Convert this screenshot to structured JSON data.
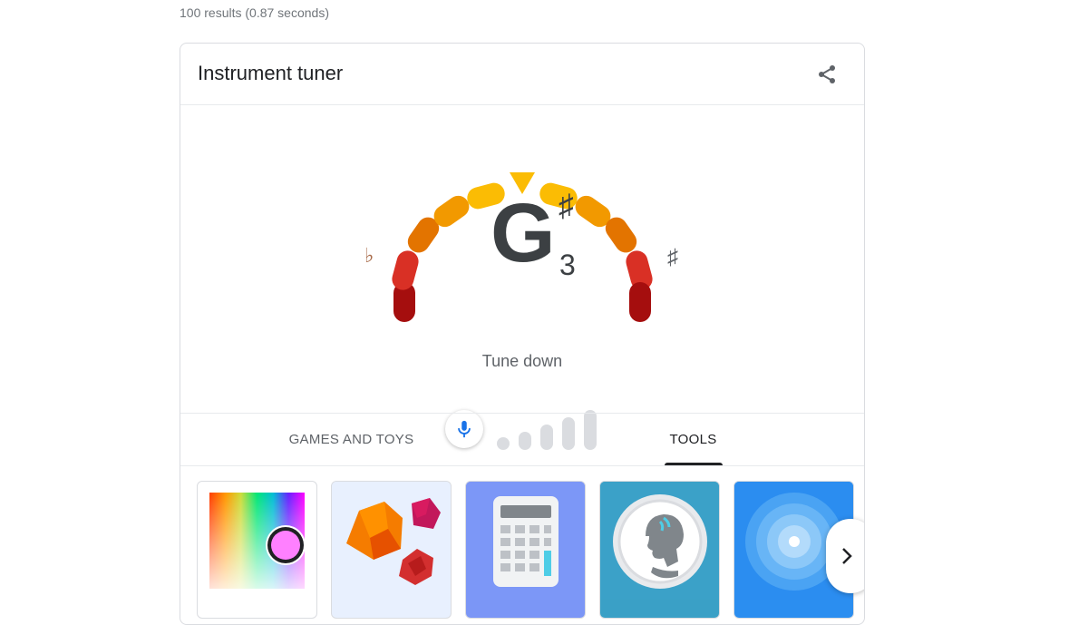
{
  "results_stats": "100 results (0.87 seconds)",
  "card": {
    "title": "Instrument tuner",
    "share_icon": "share-icon"
  },
  "tuner": {
    "note": "G",
    "accidental": "♯",
    "octave": "3",
    "flat_symbol": "♭",
    "sharp_symbol": "♯",
    "instruction": "Tune down",
    "mic_icon": "microphone-icon",
    "input_level_bars": 5,
    "colors": {
      "center": "#fbbc04",
      "mid": "#f29900",
      "outer": "#e37400",
      "edge": "#d93025",
      "end": "#a50e0e",
      "mic": "#1a73e8"
    }
  },
  "tabs": [
    {
      "label": "GAMES AND TOYS",
      "active": false
    },
    {
      "label": "TOOLS",
      "active": true
    }
  ],
  "carousel": {
    "tiles": [
      {
        "name": "color-picker-tile",
        "icon": "color-picker-icon"
      },
      {
        "name": "dice-roller-tile",
        "icon": "dice-icon"
      },
      {
        "name": "calculator-tile",
        "icon": "calculator-icon"
      },
      {
        "name": "coin-flip-tile",
        "icon": "coin-icon"
      },
      {
        "name": "breathing-exercise-tile",
        "icon": "breathing-circle-icon"
      }
    ],
    "next_icon": "chevron-right-icon"
  }
}
